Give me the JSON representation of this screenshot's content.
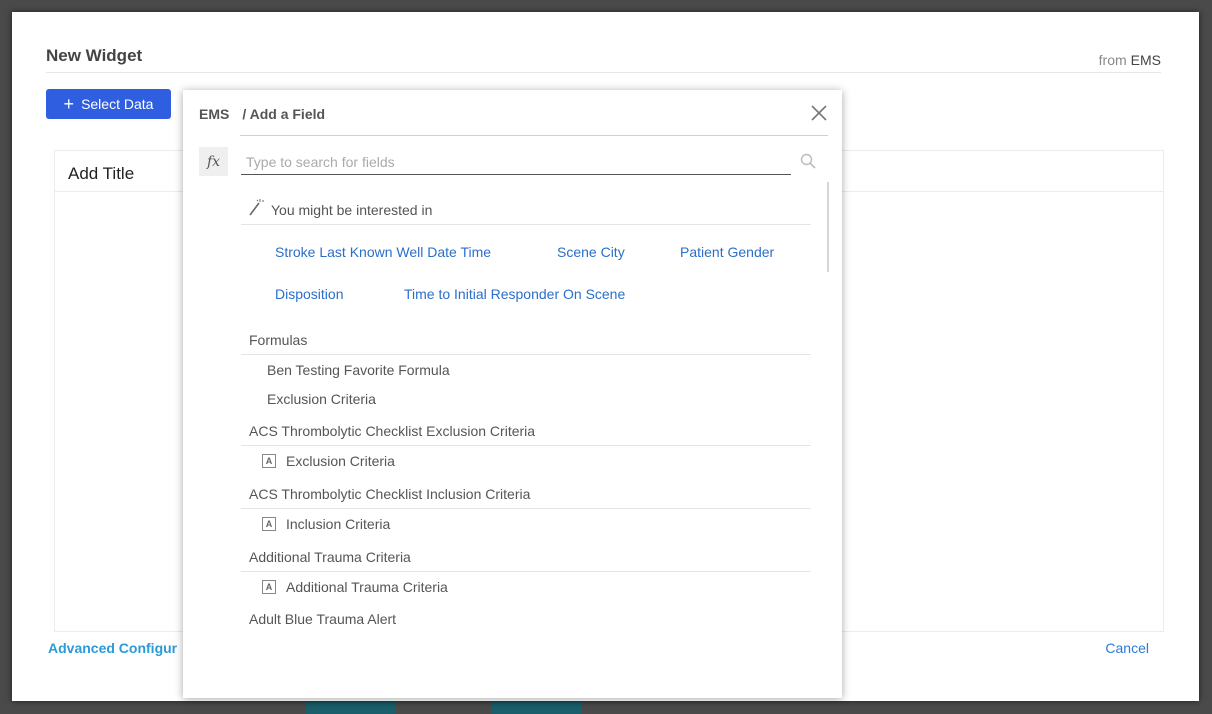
{
  "colors": {
    "primary": "#2f5fe0",
    "link": "#2b6fc9",
    "advanced_link": "#2a9bd6"
  },
  "widget": {
    "title": "New Widget",
    "from_label": "from",
    "source": "EMS",
    "select_data_label": "Select Data",
    "add_title": "Add Title",
    "advanced_configuration": "Advanced Configur",
    "cancel_label": "Cancel"
  },
  "field_picker": {
    "breadcrumb_root": "EMS",
    "breadcrumb_current": "/ Add a Field",
    "formula_icon": "fx",
    "search_placeholder": "Type to search for fields",
    "suggestions_header": "You might be interested in",
    "suggestions": [
      "Stroke Last Known Well Date Time",
      "Scene City",
      "Patient Gender",
      "Disposition",
      "Time to Initial Responder On Scene"
    ],
    "groups": [
      {
        "name": "Formulas",
        "items": [
          "Ben Testing Favorite Formula",
          "Exclusion Criteria"
        ]
      },
      {
        "name": "ACS Thrombolytic Checklist Exclusion Criteria",
        "items": [
          "Exclusion Criteria"
        ],
        "item_type_icon": "A"
      },
      {
        "name": "ACS Thrombolytic Checklist Inclusion Criteria",
        "items": [
          "Inclusion Criteria"
        ],
        "item_type_icon": "A"
      },
      {
        "name": "Additional Trauma Criteria",
        "items": [
          "Additional Trauma Criteria"
        ],
        "item_type_icon": "A"
      },
      {
        "name": "Adult Blue Trauma Alert",
        "items": []
      }
    ]
  }
}
